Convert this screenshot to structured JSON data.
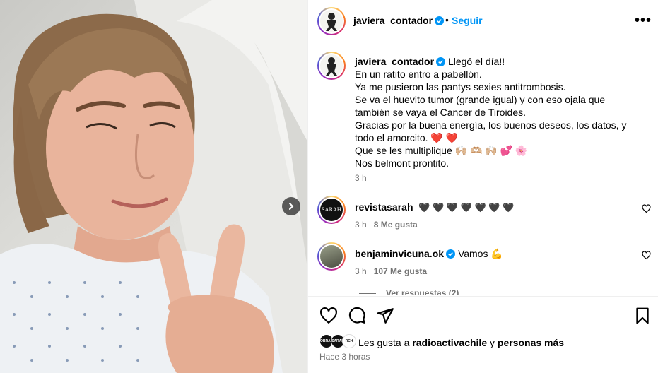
{
  "post": {
    "author": "javiera_contador",
    "separator": "•",
    "follow_label": "Seguir",
    "more_label": "•••",
    "caption_lines": [
      "Llegó el día!!",
      "En un ratito entro a pabellón.",
      "Ya me pusieron las pantys sexies antitrombosis.",
      "Se va el huevito tumor (grande igual) y con eso ojala que",
      "también se vaya el Cancer de Tiroides.",
      "Gracias por la buena energía, los buenos deseos, los datos, y",
      "todo el amorcito. ❤️ ❤️",
      "Que se les multiplique 🙌🏼 🫶🏼 🙌🏼 💕 🌸",
      "Nos belmont prontito."
    ],
    "caption_time": "3 h"
  },
  "comments": [
    {
      "user": "revistasarah",
      "text": "🖤 🖤 🖤 🖤 🖤 🖤 🖤",
      "time": "3 h",
      "likes": "8 Me gusta",
      "avatar_label": "SARAH"
    },
    {
      "user": "benjaminvicuna.ok",
      "text": "Vamos 💪",
      "time": "3 h",
      "likes": "107 Me gusta"
    }
  ],
  "see_replies": "Ver respuestas (2)",
  "likes": {
    "prefix": "Les gusta a",
    "user": "radioactivachile",
    "connector": "y",
    "others": "personas más",
    "mini_avatar_1": "OBRAS",
    "mini_avatar_2": "SARAH",
    "mini_avatar_3": "RCH"
  },
  "time_ago": "Hace 3 horas",
  "colors": {
    "accent": "#0095f6",
    "muted": "#737373",
    "like_red": "#ed4956"
  },
  "icons": [
    "verified-badge-icon",
    "more-options-icon",
    "heart-icon",
    "comment-icon",
    "share-icon",
    "bookmark-icon",
    "chevron-right-icon"
  ]
}
